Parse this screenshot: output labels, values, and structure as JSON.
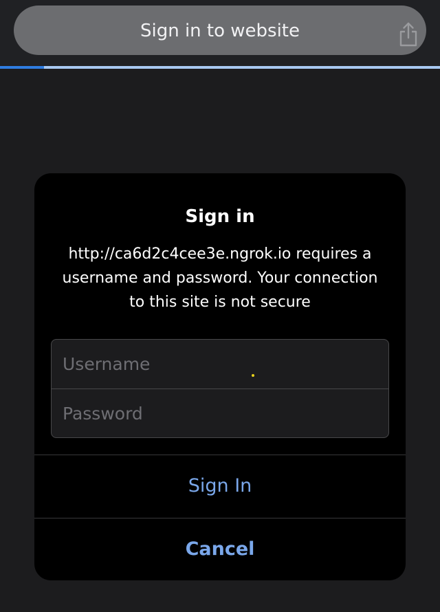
{
  "browser": {
    "title": "Sign in to website",
    "share_icon": "share-icon",
    "load_progress": 0.1,
    "colors": {
      "pill": "#6c6d70",
      "progress_fill": "#2f7de1",
      "progress_track": "#a8c9f2"
    }
  },
  "dialog": {
    "title": "Sign in",
    "message": "http://ca6d2c4cee3e.ngrok.io requires a username and password. Your connection to this site is not secure",
    "username": {
      "value": "",
      "placeholder": "Username"
    },
    "password": {
      "value": "",
      "placeholder": "Password"
    },
    "sign_in_label": "Sign In",
    "cancel_label": "Cancel",
    "colors": {
      "background": "#000000",
      "action": "#7aa7ea"
    }
  }
}
